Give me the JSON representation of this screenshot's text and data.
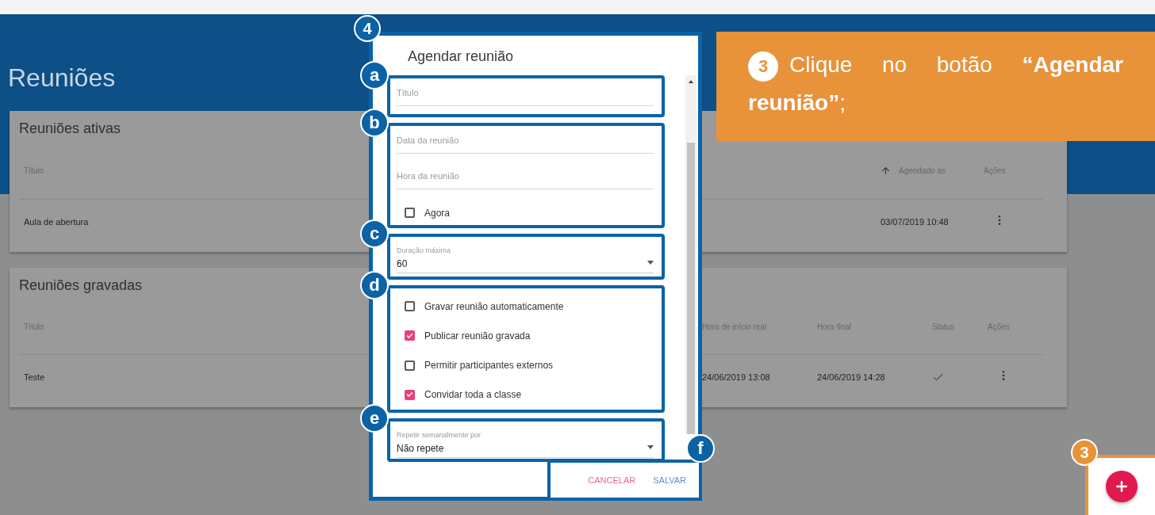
{
  "page": {
    "title": "Reuniões"
  },
  "tables": [
    {
      "title": "Reuniões ativas",
      "columns": [
        {
          "label": "Título",
          "kind": "text",
          "sorted": false
        },
        {
          "label": "Agendado às",
          "kind": "text",
          "sorted": true
        },
        {
          "label": "Ações",
          "kind": "actions",
          "sorted": false
        }
      ],
      "rows": [
        {
          "cells": [
            "Aula de abertura",
            "03/07/2019 10:48"
          ]
        }
      ]
    },
    {
      "title": "Reuniões gravadas",
      "columns": [
        {
          "label": "Título",
          "kind": "text",
          "sorted": false
        },
        {
          "label": "Hora de início real",
          "kind": "text",
          "sorted": false
        },
        {
          "label": "Hora final",
          "kind": "text",
          "sorted": false
        },
        {
          "label": "Status",
          "kind": "status",
          "sorted": false
        },
        {
          "label": "Ações",
          "kind": "actions",
          "sorted": false
        }
      ],
      "rows": [
        {
          "cells": [
            "Teste",
            "24/06/2019 13:08",
            "24/06/2019 14:28"
          ],
          "done": true
        }
      ]
    }
  ],
  "dialog": {
    "step": "4",
    "title": "Agendar reunião",
    "groups": [
      {
        "badge": "a",
        "fields": [
          {
            "kind": "text",
            "placeholder": "Título"
          }
        ]
      },
      {
        "badge": "b",
        "fields": [
          {
            "kind": "text",
            "placeholder": "Data da reunião"
          },
          {
            "kind": "text",
            "placeholder": "Hora da reunião"
          },
          {
            "kind": "checkbox",
            "label": "Agora",
            "checked": false
          }
        ]
      },
      {
        "badge": "c",
        "fields": [
          {
            "kind": "select",
            "label": "Duração máxima",
            "value": "60"
          }
        ]
      },
      {
        "badge": "d",
        "fields": [
          {
            "kind": "checkbox",
            "label": "Gravar reunião automaticamente",
            "checked": false
          },
          {
            "kind": "checkbox",
            "label": "Publicar reunião gravada",
            "checked": true
          },
          {
            "kind": "checkbox",
            "label": "Permitir participantes externos",
            "checked": false
          },
          {
            "kind": "checkbox",
            "label": "Convidar toda a classe",
            "checked": true
          }
        ]
      },
      {
        "badge": "e",
        "fields": [
          {
            "kind": "select",
            "label": "Repetir semanalmente por",
            "value": "Não repete"
          }
        ]
      }
    ],
    "actions": {
      "badge": "f",
      "buttons": [
        {
          "label": "CANCELAR",
          "kind": "cancel"
        },
        {
          "label": "SALVAR",
          "kind": "primary"
        }
      ]
    }
  },
  "callout": {
    "step": "3",
    "text": "Clique no botão **“Agendar reunião”**;"
  },
  "fab": {
    "step": "3"
  }
}
